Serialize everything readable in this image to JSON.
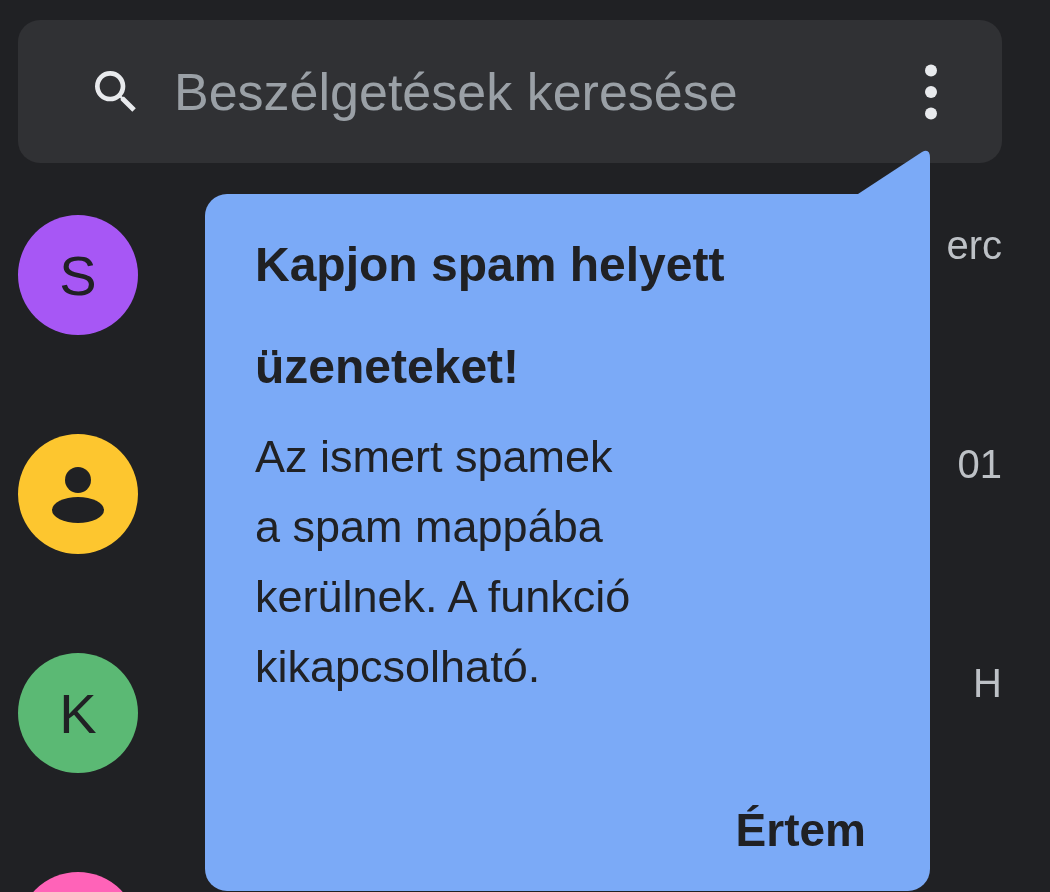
{
  "search": {
    "placeholder": "Beszélgetések keresése"
  },
  "conversations": [
    {
      "avatar": {
        "kind": "letter",
        "letter": "S",
        "color": "#a757f5"
      },
      "time": "erc"
    },
    {
      "avatar": {
        "kind": "person",
        "color": "#fdc62f"
      },
      "time": "01"
    },
    {
      "avatar": {
        "kind": "letter",
        "letter": "K",
        "color": "#5bb974"
      },
      "time": "H"
    },
    {
      "avatar": {
        "kind": "blank",
        "color": "#ff63b8"
      }
    }
  ],
  "tooltip": {
    "title": "Kapjon spam helyett üzeneteket!",
    "body": "Az ismert spamek a spam mappába kerülnek. A funkció kikapcsolható.",
    "button": "Értem"
  }
}
